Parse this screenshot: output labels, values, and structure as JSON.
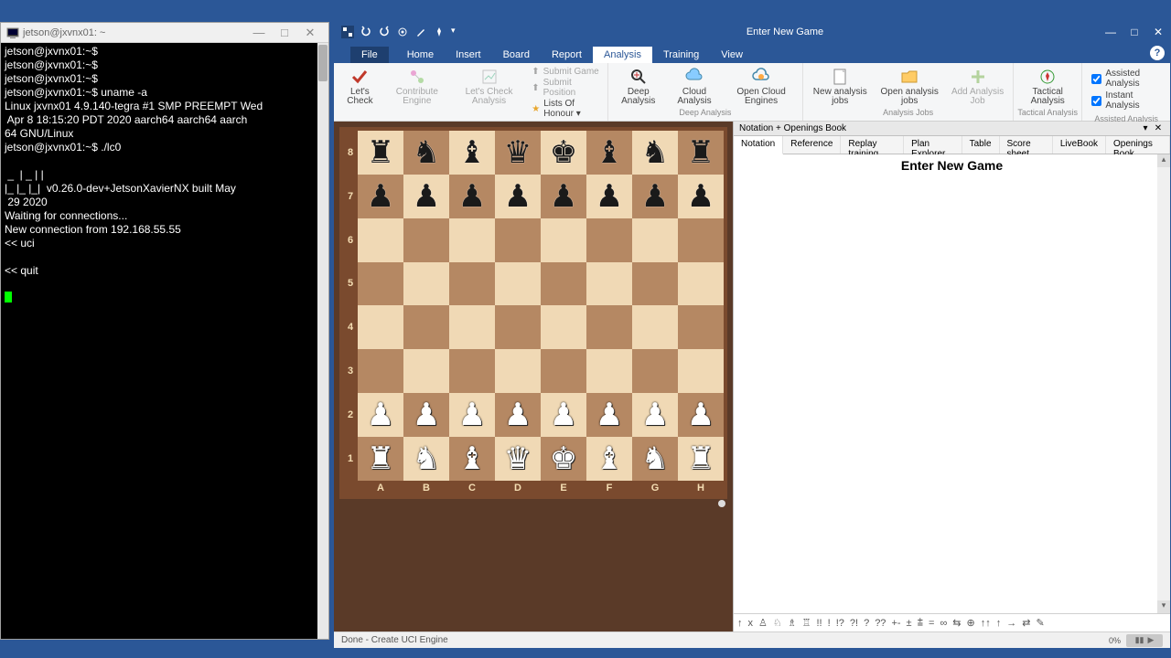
{
  "terminal": {
    "title": "jetson@jxvnx01: ~",
    "lines": [
      "jetson@jxvnx01:~$",
      "jetson@jxvnx01:~$",
      "jetson@jxvnx01:~$",
      "jetson@jxvnx01:~$ uname -a",
      "Linux jxvnx01 4.9.140-tegra #1 SMP PREEMPT Wed",
      " Apr 8 18:15:20 PDT 2020 aarch64 aarch64 aarch",
      "64 GNU/Linux",
      "jetson@jxvnx01:~$ ./lc0",
      "",
      " _  | _ | |",
      "|_ |_ |_|  v0.26.0-dev+JetsonXavierNX built May",
      " 29 2020",
      "Waiting for connections...",
      "New connection from 192.168.55.55",
      "<< uci",
      "",
      "<< quit",
      ""
    ]
  },
  "chess": {
    "title": "Enter New Game",
    "tabs": {
      "file": "File",
      "list": [
        "Home",
        "Insert",
        "Board",
        "Report",
        "Analysis",
        "Training",
        "View"
      ],
      "active": "Analysis"
    },
    "ribbon": {
      "letscheck": {
        "label": "Let's Check",
        "items": {
          "lets_check": "Let's\nCheck",
          "contribute": "Contribute\nEngine",
          "lets_check_analysis": "Let's Check\nAnalysis",
          "submit_game": "Submit Game",
          "submit_position": "Submit Position",
          "lists_of_honour": "Lists Of Honour ▾"
        }
      },
      "deep": {
        "label": "Deep Analysis",
        "items": {
          "deep_analysis": "Deep\nAnalysis",
          "cloud_analysis": "Cloud\nAnalysis",
          "open_cloud_engines": "Open Cloud\nEngines"
        }
      },
      "jobs": {
        "label": "Analysis Jobs",
        "items": {
          "new_jobs": "New\nanalysis jobs",
          "open_jobs": "Open\nanalysis jobs",
          "add_job": "Add\nAnalysis Job"
        }
      },
      "tactical": {
        "label": "Tactical Analysis",
        "items": {
          "tactical": "Tactical\nAnalysis"
        }
      },
      "assisted": {
        "label": "Assisted Analysis",
        "checks": {
          "assisted": "Assisted Analysis",
          "instant": "Instant Analysis"
        }
      }
    },
    "board": {
      "files": [
        "A",
        "B",
        "C",
        "D",
        "E",
        "F",
        "G",
        "H"
      ],
      "ranks": [
        "8",
        "7",
        "6",
        "5",
        "4",
        "3",
        "2",
        "1"
      ],
      "position": [
        [
          "r",
          "n",
          "b",
          "q",
          "k",
          "b",
          "n",
          "r"
        ],
        [
          "p",
          "p",
          "p",
          "p",
          "p",
          "p",
          "p",
          "p"
        ],
        [
          "",
          "",
          "",
          "",
          "",
          "",
          "",
          ""
        ],
        [
          "",
          "",
          "",
          "",
          "",
          "",
          "",
          ""
        ],
        [
          "",
          "",
          "",
          "",
          "",
          "",
          "",
          ""
        ],
        [
          "",
          "",
          "",
          "",
          "",
          "",
          "",
          ""
        ],
        [
          "P",
          "P",
          "P",
          "P",
          "P",
          "P",
          "P",
          "P"
        ],
        [
          "R",
          "N",
          "B",
          "Q",
          "K",
          "B",
          "N",
          "R"
        ]
      ]
    },
    "right_pane": {
      "header": "Notation + Openings Book",
      "tabs": [
        "Notation",
        "Reference",
        "Replay training",
        "Plan Explorer",
        "Table",
        "Score sheet",
        "LiveBook",
        "Openings Book"
      ],
      "active_tab": "Notation",
      "game_title": "Enter New Game",
      "toolbar_glyphs": [
        "↑",
        "x",
        "♙",
        "♘",
        "♗",
        "♖",
        "!!",
        "!",
        "!?",
        "?!",
        "?",
        "??",
        "+-",
        "±",
        "⩲",
        "=",
        "∞",
        "⇆",
        "⊕",
        "↑↑",
        "↑",
        "→",
        "⇄",
        "✎"
      ]
    },
    "status": {
      "text": "Done - Create UCI Engine",
      "percent": "0%"
    }
  }
}
